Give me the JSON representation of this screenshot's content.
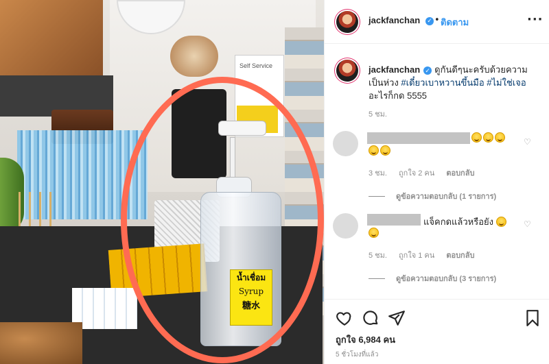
{
  "photo": {
    "sign_text": "Self Service",
    "bottle_label": {
      "line1": "น้ำเชื่อม",
      "line2": "Syrup",
      "line3": "糖水"
    }
  },
  "header": {
    "username": "jackfanchan",
    "verified_icon": "verified-badge-icon",
    "separator": "•",
    "follow_label": "ติดตาม",
    "more_label": "···"
  },
  "caption": {
    "username": "jackfanchan",
    "text_before": "ดูกันดีๆนะครับด้วยความเป็นห่วง ",
    "hashtag1": "#เดี๋ยวเบาหวานขึ้นมือ",
    "hashtag2": "#ไม่ใช่เจอ",
    "text_after": "อะไรก็กด 5555",
    "time": "5 ชม."
  },
  "comments": [
    {
      "text": "",
      "emoji_count_line1": 3,
      "emoji_count_line2": 2,
      "time": "3 ชม.",
      "likes": "ถูกใจ 2 คน",
      "reply_label": "ตอบกลับ",
      "view_replies": "ดูข้อความตอบกลับ (1 รายการ)"
    },
    {
      "text": "แจ็คกดแล้วหรือยัง",
      "time": "5 ชม.",
      "likes": "ถูกใจ 1 คน",
      "reply_label": "ตอบกลับ",
      "view_replies": "ดูข้อความตอบกลับ (3 รายการ)"
    }
  ],
  "actions": {
    "likes_text": "ถูกใจ 6,984 คน",
    "posted_time": "5 ชั่วโมงที่แล้ว"
  },
  "colors": {
    "accent": "#3897f0",
    "circle": "#ff6b52",
    "label_yellow": "#fbe512",
    "muted": "#8e8e8e"
  }
}
